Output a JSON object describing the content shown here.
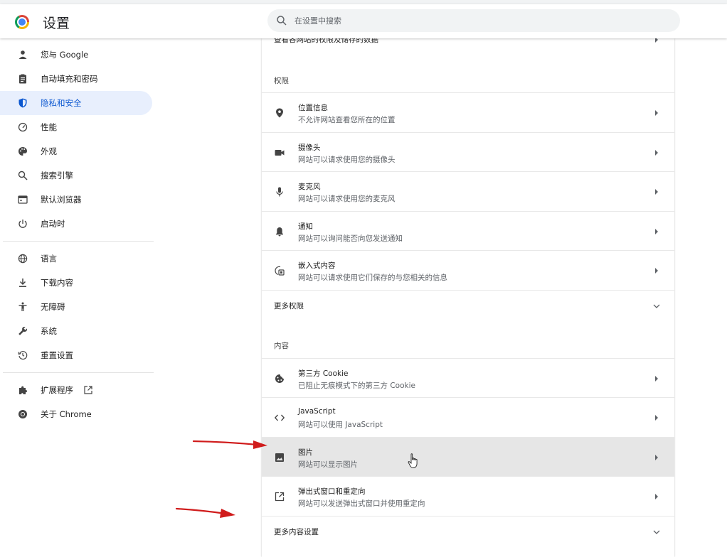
{
  "header": {
    "title": "设置",
    "search_placeholder": "在设置中搜索"
  },
  "sidebar": {
    "items": [
      {
        "label": "您与 Google",
        "icon": "person-icon"
      },
      {
        "label": "自动填充和密码",
        "icon": "clipboard-icon"
      },
      {
        "label": "隐私和安全",
        "icon": "shield-icon",
        "active": true
      },
      {
        "label": "性能",
        "icon": "speedometer-icon"
      },
      {
        "label": "外观",
        "icon": "palette-icon"
      },
      {
        "label": "搜索引擎",
        "icon": "search-icon"
      },
      {
        "label": "默认浏览器",
        "icon": "browser-icon"
      },
      {
        "label": "启动时",
        "icon": "power-icon"
      },
      {
        "label": "语言",
        "icon": "globe-icon"
      },
      {
        "label": "下载内容",
        "icon": "download-icon"
      },
      {
        "label": "无障碍",
        "icon": "accessibility-icon"
      },
      {
        "label": "系统",
        "icon": "wrench-icon"
      },
      {
        "label": "重置设置",
        "icon": "history-reset-icon"
      },
      {
        "label": "扩展程序",
        "icon": "puzzle-icon",
        "external_icon": "open-in-new-icon"
      },
      {
        "label": "关于 Chrome",
        "icon": "chrome-icon"
      }
    ]
  },
  "content": {
    "top_row_label": "查看各网站的权限及储存的数据",
    "permissions_heading": "权限",
    "permissions": [
      {
        "title": "位置信息",
        "subtitle": "不允许网站查看您所在的位置",
        "icon": "location-pin-icon"
      },
      {
        "title": "摄像头",
        "subtitle": "网站可以请求使用您的摄像头",
        "icon": "camera-icon"
      },
      {
        "title": "麦克风",
        "subtitle": "网站可以请求使用您的麦克风",
        "icon": "microphone-icon"
      },
      {
        "title": "通知",
        "subtitle": "网站可以询问能否向您发送通知",
        "icon": "bell-icon"
      },
      {
        "title": "嵌入式内容",
        "subtitle": "网站可以请求使用它们保存的与您相关的信息",
        "icon": "embedded-content-icon"
      }
    ],
    "more_permissions": "更多权限",
    "content_heading": "内容",
    "content_items": [
      {
        "title": "第三方 Cookie",
        "subtitle": "已阻止无痕模式下的第三方 Cookie",
        "icon": "cookie-icon"
      },
      {
        "title": "JavaScript",
        "subtitle": "网站可以使用 JavaScript",
        "icon": "code-icon"
      },
      {
        "title": "图片",
        "subtitle": "网站可以显示图片",
        "icon": "image-icon",
        "hovered": true
      },
      {
        "title": "弹出式窗口和重定向",
        "subtitle": "网站可以发送弹出式窗口并使用重定向",
        "icon": "open-in-new-icon"
      }
    ],
    "more_content": "更多内容设置"
  },
  "colors": {
    "accent": "#0b57d0",
    "active_nav_bg": "#e8effd",
    "hover_row_bg": "#e6e6e6",
    "annotation_arrow": "#d01c1c"
  }
}
